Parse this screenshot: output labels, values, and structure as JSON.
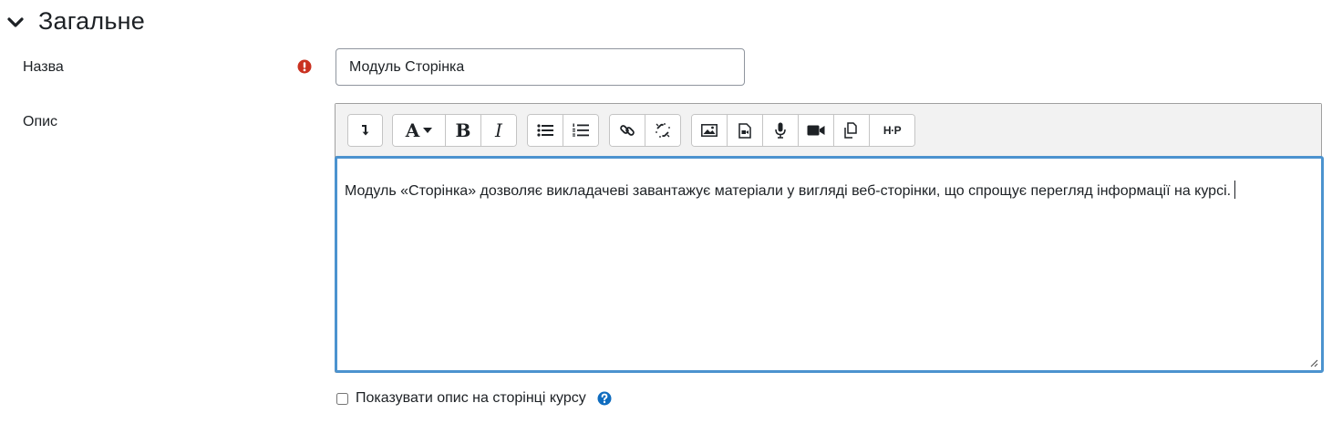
{
  "section": {
    "title": "Загальне",
    "icon": "chevron-down-icon"
  },
  "fields": {
    "name": {
      "label": "Назва",
      "value": "Модуль Сторінка",
      "required_icon": "exclamation-circle-icon"
    },
    "description": {
      "label": "Опис",
      "content": "Модуль «Сторінка» дозволяє викладачеві завантажує матеріали у вигляді веб-сторінки, що спрощує перегляд інформації на курсі."
    }
  },
  "toolbar": {
    "text_format_label": "A",
    "bold_label": "B",
    "italic_label": "I",
    "h5p_label": "H·P",
    "icons": [
      "toggle-toolbar-icon",
      "font-style-icon",
      "bold-icon",
      "italic-icon",
      "unordered-list-icon",
      "ordered-list-icon",
      "link-icon",
      "unlink-icon",
      "image-icon",
      "media-icon",
      "record-audio-icon",
      "record-video-icon",
      "manage-files-icon",
      "h5p-icon"
    ]
  },
  "show_description": {
    "label": "Показувати опис на сторінці курсу",
    "checked": false,
    "help_icon": "question-circle-icon"
  },
  "colors": {
    "accent": "#4c93cf",
    "required": "#ca3120",
    "help": "#0f6cbf"
  }
}
